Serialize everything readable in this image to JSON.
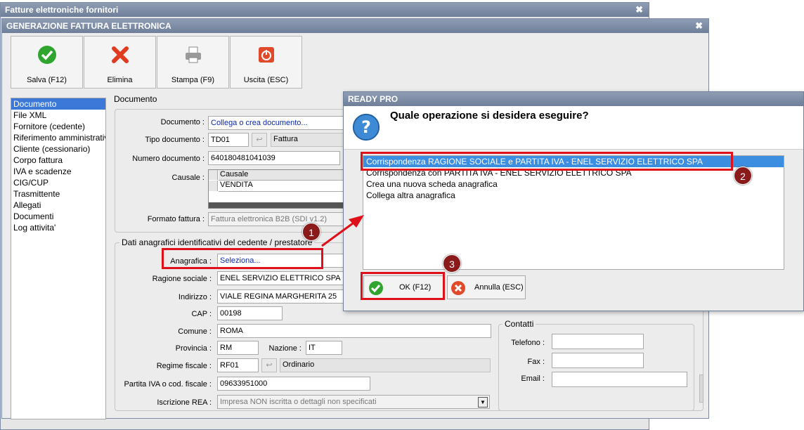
{
  "outer_window": {
    "title": "Fatture elettroniche fornitori"
  },
  "inner_window": {
    "title": "GENERAZIONE FATTURA ELETTRONICA"
  },
  "toolbar": {
    "save_label": "Salva (F12)",
    "delete_label": "Elimina",
    "print_label": "Stampa (F9)",
    "exit_label": "Uscita (ESC)"
  },
  "nav": {
    "items": [
      {
        "label": "Documento"
      },
      {
        "label": "File XML"
      },
      {
        "label": "Fornitore (cedente)"
      },
      {
        "label": "Riferimento amministrativo"
      },
      {
        "label": "Cliente (cessionario)"
      },
      {
        "label": "Corpo fattura"
      },
      {
        "label": "IVA e scadenze"
      },
      {
        "label": "CIG/CUP"
      },
      {
        "label": "Trasmittente"
      },
      {
        "label": "Allegati"
      },
      {
        "label": "Documenti"
      },
      {
        "label": "Log attivita'"
      }
    ]
  },
  "documento": {
    "group_label": "Documento",
    "documento_label": "Documento :",
    "documento_value": "Collega o crea documento...",
    "tipo_label": "Tipo documento :",
    "tipo_code": "TD01",
    "tipo_desc": "Fattura",
    "numero_label": "Numero documento :",
    "numero_value": "640180481041039",
    "causale_label": "Causale :",
    "causale_header": "Causale",
    "causale_row": "VENDITA",
    "formato_label": "Formato fattura :",
    "formato_value": "Fattura elettronica B2B (SDI v1.2)"
  },
  "cedente": {
    "group_label": "Dati anagrafici identificativi del cedente / prestatore",
    "anagrafica_label": "Anagrafica :",
    "anagrafica_value": "Seleziona...",
    "ragione_label": "Ragione sociale :",
    "ragione_value": "ENEL SERVIZIO ELETTRICO SPA",
    "indirizzo_label": "Indirizzo :",
    "indirizzo_value": "VIALE REGINA MARGHERITA 25",
    "cap_label": "CAP :",
    "cap_value": "00198",
    "comune_label": "Comune :",
    "comune_value": "ROMA",
    "provincia_label": "Provincia :",
    "provincia_value": "RM",
    "nazione_label": "Nazione :",
    "nazione_value": "IT",
    "regime_label": "Regime fiscale :",
    "regime_code": "RF01",
    "regime_desc": "Ordinario",
    "piva_label": "Partita IVA o cod. fiscale :",
    "piva_value": "09633951000",
    "rea_label": "Iscrizione REA :",
    "rea_value": "Impresa NON iscritta o dettagli non specificati"
  },
  "contatti": {
    "group_label": "Contatti",
    "telefono_label": "Telefono :",
    "fax_label": "Fax :",
    "email_label": "Email :"
  },
  "dialog": {
    "title": "READY PRO",
    "question": "Quale operazione si desidera eseguire?",
    "options": [
      {
        "label": "Corrispondenza RAGIONE SOCIALE e PARTITA IVA - ENEL SERVIZIO ELETTRICO SPA"
      },
      {
        "label": "Corrispondenza con PARTITA IVA - ENEL SERVIZIO ELETTRICO SPA"
      },
      {
        "label": "Crea una nuova scheda anagrafica"
      },
      {
        "label": "Collega altra anagrafica"
      }
    ],
    "ok_label": "OK (F12)",
    "cancel_label": "Annulla (ESC)"
  },
  "annotations": {
    "badge1": "1",
    "badge2": "2",
    "badge3": "3"
  },
  "colors": {
    "accent_red": "#e0101a",
    "badge": "#8b1a1a",
    "selection": "#3c78d8"
  }
}
